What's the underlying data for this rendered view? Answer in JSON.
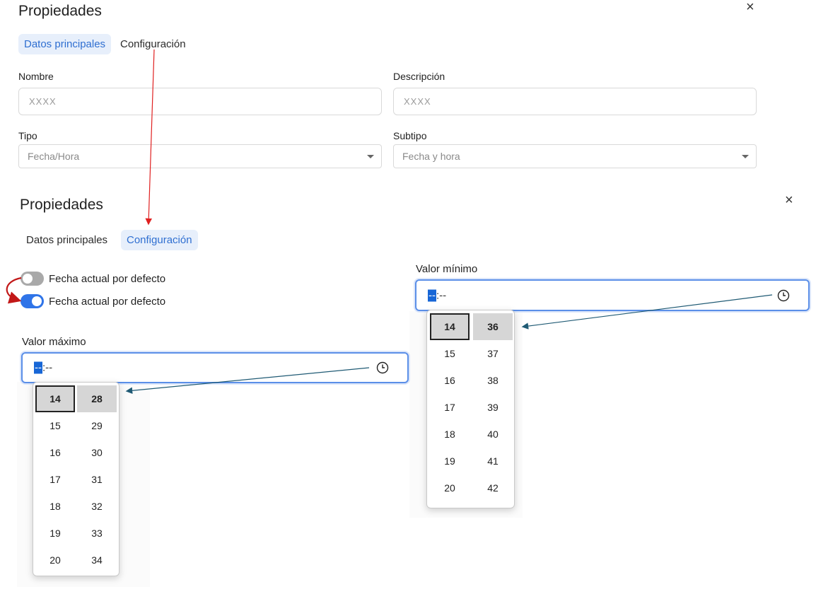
{
  "top_panel": {
    "title": "Propiedades",
    "close_glyph": "×",
    "tabs": [
      {
        "label": "Datos principales",
        "active": true
      },
      {
        "label": "Configuración",
        "active": false
      }
    ],
    "fields": {
      "nombre": {
        "label": "Nombre",
        "placeholder": "XXXX"
      },
      "descripcion": {
        "label": "Descripción",
        "placeholder": "XXXX"
      },
      "tipo": {
        "label": "Tipo",
        "value": "Fecha/Hora"
      },
      "subtipo": {
        "label": "Subtipo",
        "value": "Fecha y hora"
      }
    }
  },
  "bottom_panel": {
    "title": "Propiedades",
    "close_glyph": "×",
    "tabs": [
      {
        "label": "Datos principales",
        "active": false
      },
      {
        "label": "Configuración",
        "active": true
      }
    ],
    "toggles": [
      {
        "label": "Fecha actual por defecto",
        "state": "off"
      },
      {
        "label": "Fecha actual por defecto",
        "state": "on"
      }
    ],
    "valor_minimo": {
      "label": "Valor mínimo",
      "hour_segment": "--",
      "separator": ":",
      "minute_segment": "--",
      "hours": [
        "14",
        "15",
        "16",
        "17",
        "18",
        "19",
        "20"
      ],
      "minutes": [
        "36",
        "37",
        "38",
        "39",
        "40",
        "41",
        "42"
      ],
      "selected_hour": "14",
      "selected_minute": "36"
    },
    "valor_maximo": {
      "label": "Valor máximo",
      "hour_segment": "--",
      "separator": ":",
      "minute_segment": "--",
      "hours": [
        "14",
        "15",
        "16",
        "17",
        "18",
        "19",
        "20"
      ],
      "minutes": [
        "28",
        "29",
        "30",
        "31",
        "32",
        "33",
        "34"
      ],
      "selected_hour": "14",
      "selected_minute": "28"
    }
  },
  "icons": {
    "close": "close-icon",
    "dropdown": "chevron-down-icon",
    "clock": "clock-icon"
  },
  "colors": {
    "accent": "#2f6fd1",
    "tab_active_bg": "#e7effb",
    "toggle_on": "#2f74e8",
    "toggle_off": "#a9a9a9",
    "annotation_red": "#e02020",
    "annotation_teal": "#1f5a74"
  }
}
